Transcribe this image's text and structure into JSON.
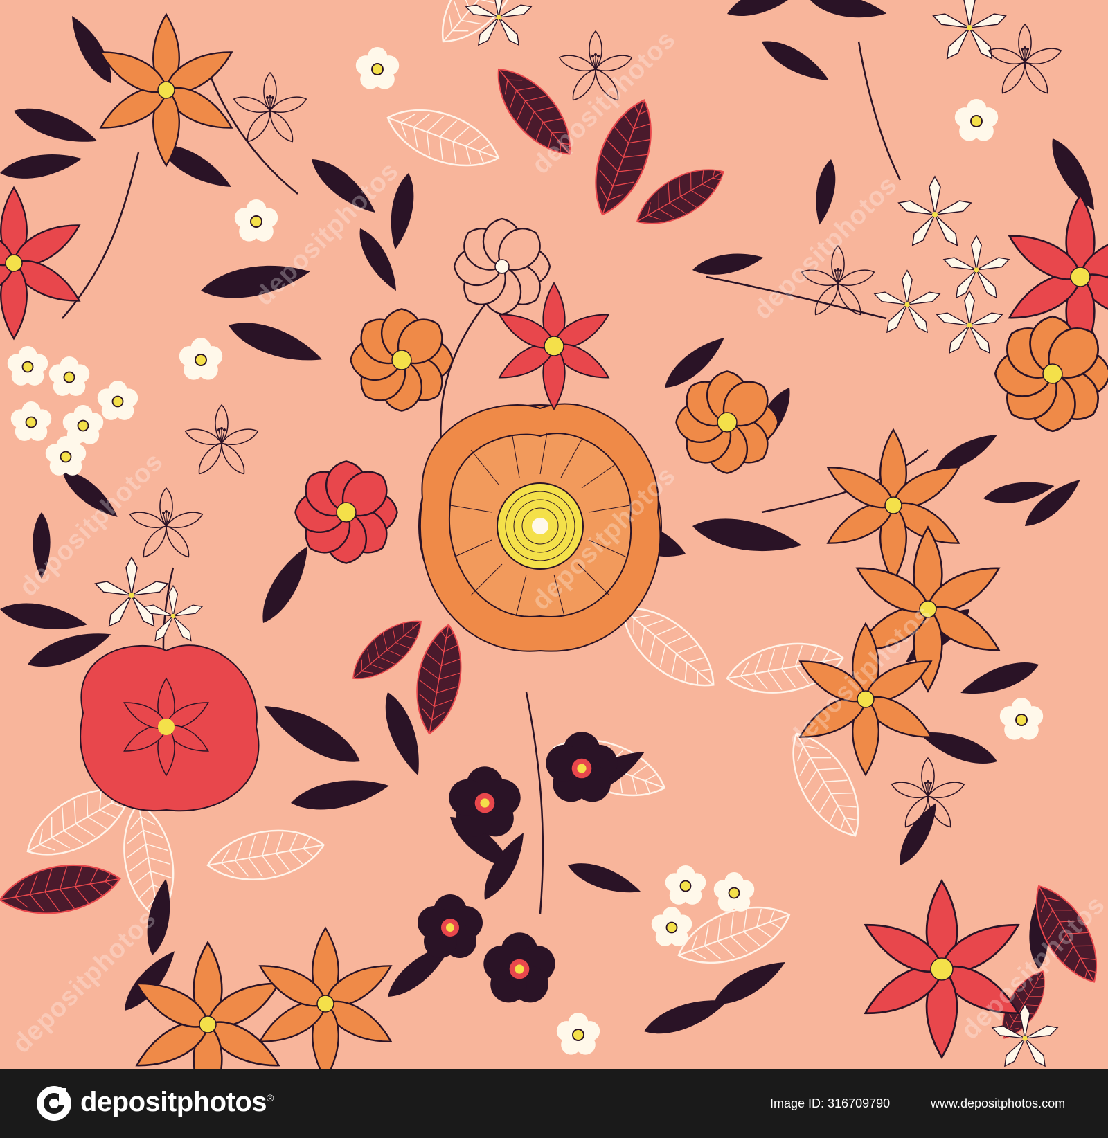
{
  "colors": {
    "background": "#f8b59b",
    "dark_leaf": "#2a1326",
    "coral": "#e8474c",
    "orange": "#ef8a48",
    "cream": "#fff8ea",
    "yellow": "#f4e04a",
    "maroon": "#4a1a2c",
    "footer_bg": "#1a1a1a"
  },
  "watermark": {
    "text": "depositphotos"
  },
  "footer": {
    "logo_icon": "depositphotos-logo-icon",
    "brand": "depositphotos",
    "brand_mark": "®",
    "image_id": "Image ID: 316709790",
    "url": "www.depositphotos.com"
  }
}
